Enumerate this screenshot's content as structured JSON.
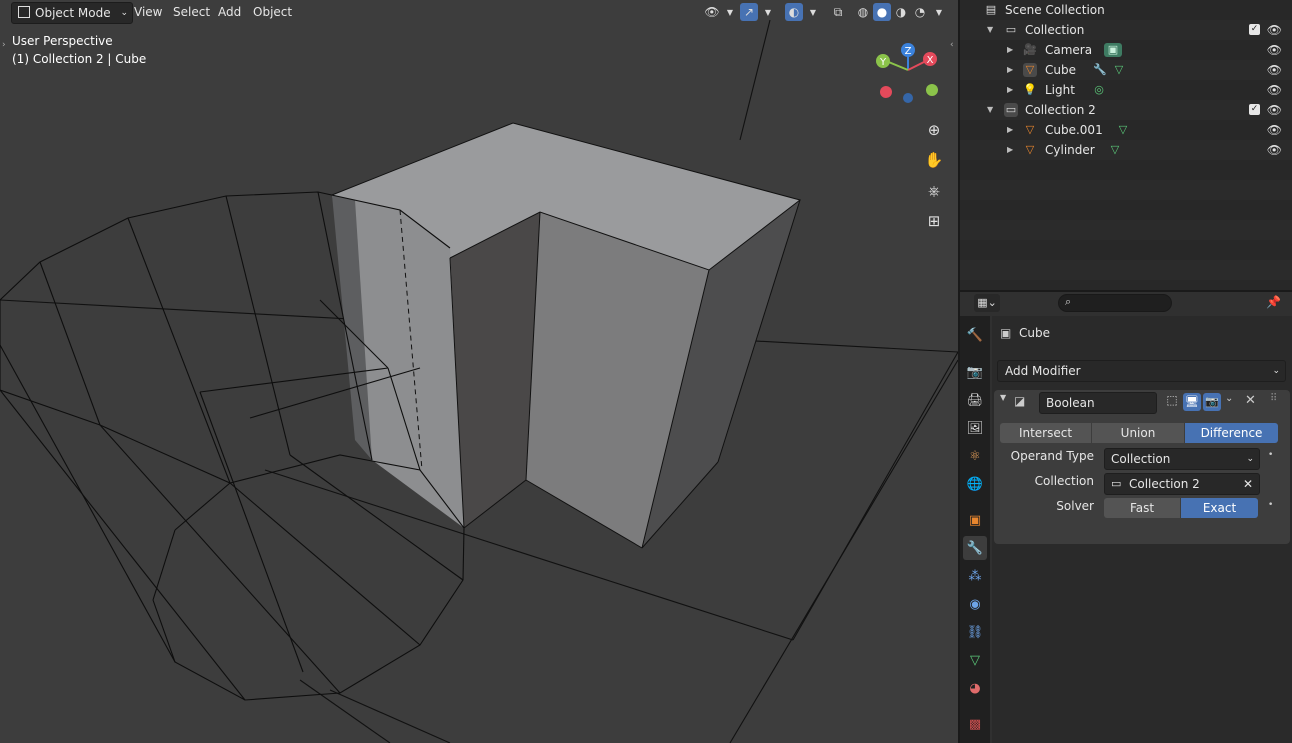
{
  "viewport": {
    "mode_label": "Object Mode",
    "menu": [
      "View",
      "Select",
      "Add",
      "Object"
    ],
    "perspective_text": "User Perspective",
    "object_text": "(1) Collection 2 | Cube",
    "gizmo": {
      "x": "X",
      "y": "Y",
      "z": "Z"
    }
  },
  "outliner": {
    "rows": [
      {
        "label": "Scene Collection"
      },
      {
        "label": "Collection"
      },
      {
        "label": "Camera"
      },
      {
        "label": "Cube"
      },
      {
        "label": "Light"
      },
      {
        "label": "Collection 2"
      },
      {
        "label": "Cube.001"
      },
      {
        "label": "Cylinder"
      }
    ]
  },
  "properties": {
    "search_placeholder": "",
    "object_name": "Cube",
    "add_modifier_label": "Add Modifier",
    "modifier": {
      "name": "Boolean",
      "operations": [
        "Intersect",
        "Union",
        "Difference"
      ],
      "active_operation": "Difference",
      "operand_type_label": "Operand Type",
      "operand_type_value": "Collection",
      "collection_label": "Collection",
      "collection_value": "Collection 2",
      "solver_label": "Solver",
      "solver_options": [
        "Fast",
        "Exact"
      ],
      "active_solver": "Exact"
    }
  },
  "colors": {
    "accent": "#4772b3",
    "axis_x": "#e44a5b",
    "axis_y": "#8bc34a",
    "axis_z": "#3b82dc",
    "object_orange": "#e8862e",
    "mesh_green": "#5bc97a"
  }
}
